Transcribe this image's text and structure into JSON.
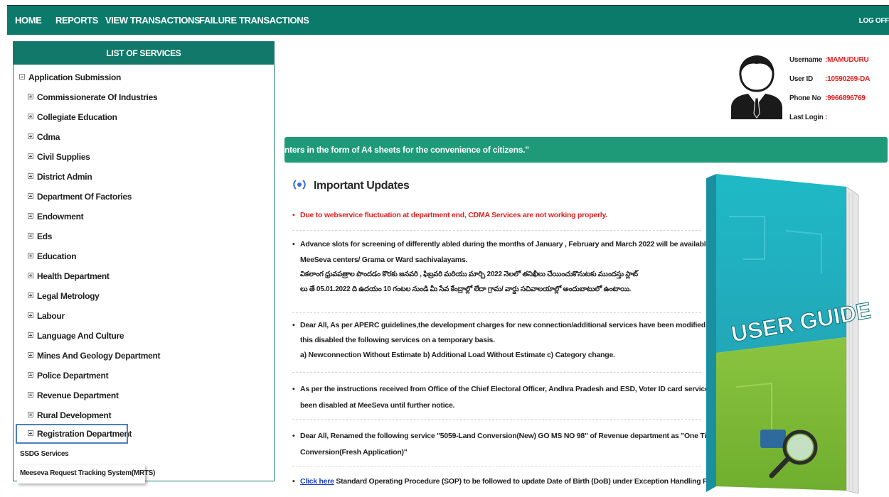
{
  "nav": {
    "items": [
      "HOME",
      "REPORTS",
      "VIEW TRANSACTIONS",
      "FAILURE TRANSACTIONS"
    ],
    "logoff": "LOG OFF"
  },
  "services": {
    "header": "LIST OF SERVICES",
    "root": "Application Submission",
    "items": [
      "Commissionerate Of Industries",
      "Collegiate Education",
      "Cdma",
      "Civil Supplies",
      "District Admin",
      "Department Of Factories",
      "Endowment",
      "Eds",
      "Education",
      "Health Department",
      "Legal Metrology",
      "Labour",
      "Language And Culture",
      "Mines And Geology Department",
      "Police Department",
      "Revenue Department",
      "Rural Development",
      "Registration Department"
    ],
    "extra": [
      "SSDG Services",
      "Meeseva Request Tracking System(MRTS)"
    ]
  },
  "user": {
    "username_label": "Username",
    "username": ":MAMUDURU",
    "userid_label": "User ID",
    "userid": ":10590269-DA",
    "phone_label": "Phone No",
    "phone": ":9966896769",
    "lastlogin_label": "Last Login",
    "lastlogin": ":"
  },
  "marquee": "nters in the form of  A4 sheets for the convenience of citizens.\"",
  "updates": {
    "title": "Important Updates",
    "item1": "Due to webservice fluctuation at department end, CDMA Services are not working properly.",
    "item2_l1": "Advance slots for screening of differently abled during the months of January , February and March 2022 will be available in",
    "item2_l2": "MeeSeva centers/ Grama or Ward sachivalayams.",
    "item2_l3": "వికలాంగ ధ్రువపత్రాల పొందడం కొరకు జనవరి , ఫిబ్రవరి మరియు మార్చి 2022 నెలలో తనిఖీలు చేయించుకొనుటకు ముందస్తు స్లాట్",
    "item2_l4": "లు తే 05.01.2022 ది ఉదయం 10 గంటల నుండి మీ సేవ కేంద్రాల్లో లేదా గ్రామ/ వార్డు సచివాలయాల్లో అందుబాటులో ఉంటాయి.",
    "item3_l1": "Dear All, As per APERC guidelines,the development charges for new connection/additional services have been modified due to",
    "item3_l2": "this disabled the following services on a temporary basis.",
    "item3_l3": "a) Newconnection Without Estimate b) Additional Load Without Estimate c) Category change.",
    "item4_l1": "As per the instructions received from Office of the Chief Electoral Officer, Andhra Pradesh and ESD, Voter ID card services have",
    "item4_l2": "been disabled at MeeSeva until further notice.",
    "item5_l1": "Dear All, Renamed the following service \"5059-Land Conversion(New) GO MS NO 98\" of Revenue department as \"One Time",
    "item5_l2": "Conversion(Fresh Application)\"",
    "item6_link": "Click here",
    "item6_text": " Standard Operating Procedure (SOP) to be followed to update Date of Birth (DoB) under Exception Handling Process."
  },
  "guide": {
    "label": "USER GUIDE"
  },
  "colors": {
    "teal": "#0b7a6a",
    "marquee": "#1f9a78",
    "alert": "#e32020",
    "link": "#1a3fcc"
  }
}
